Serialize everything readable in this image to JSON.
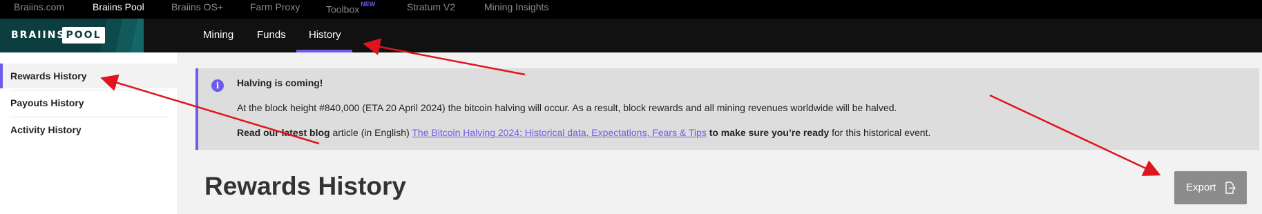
{
  "top_nav": {
    "items": [
      {
        "label": "Braiins.com"
      },
      {
        "label": "Braiins Pool"
      },
      {
        "label": "Braiins OS+"
      },
      {
        "label": "Farm Proxy"
      },
      {
        "label": "Toolbox",
        "badge": "NEW"
      },
      {
        "label": "Stratum V2"
      },
      {
        "label": "Mining Insights"
      }
    ],
    "active": "Braiins Pool"
  },
  "logo": {
    "text": "BRAIINS",
    "badge": "POOL"
  },
  "pool_nav": {
    "tabs": [
      {
        "label": "Mining"
      },
      {
        "label": "Funds"
      },
      {
        "label": "History"
      }
    ],
    "active": "History"
  },
  "sidebar": {
    "items": [
      {
        "label": "Rewards History"
      },
      {
        "label": "Payouts History"
      },
      {
        "label": "Activity History"
      }
    ],
    "active": "Rewards History"
  },
  "notice": {
    "icon": "info-icon",
    "title": "Halving is coming!",
    "body": "At the block height #840,000 (ETA 20 April 2024) the bitcoin halving will occur. As a result, block rewards and all mining revenues worldwide will be halved.",
    "line3_bold_start": "Read our latest blog",
    "line3_middle": " article (in English) ",
    "line3_link": "The Bitcoin Halving 2024: Historical data, Expectations, Fears & Tips",
    "line3_bold_end": " to make sure you’re ready",
    "line3_end": " for this historical event."
  },
  "page": {
    "title": "Rewards History"
  },
  "export": {
    "label": "Export",
    "icon": "export-icon"
  },
  "colors": {
    "accent": "#6c5ce7",
    "arrow": "#e0141e",
    "logo_bg": "#0c3d3f"
  }
}
